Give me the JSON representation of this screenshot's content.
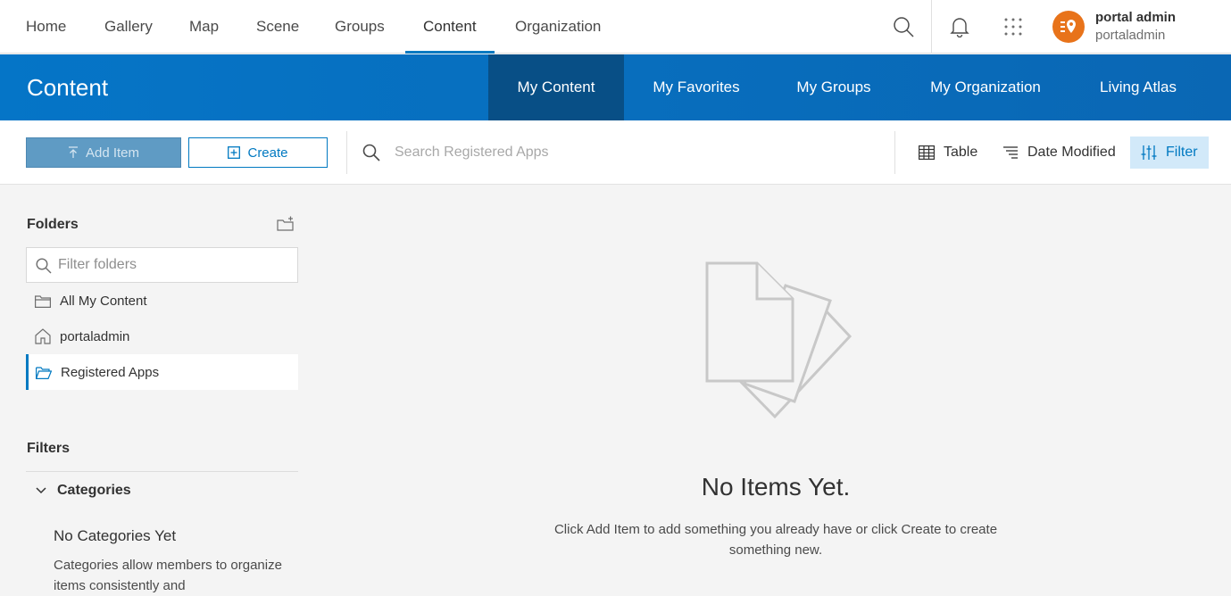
{
  "topnav": {
    "items": [
      "Home",
      "Gallery",
      "Map",
      "Scene",
      "Groups",
      "Content",
      "Organization"
    ],
    "active": "Content",
    "user": {
      "name": "portal admin",
      "handle": "portaladmin"
    }
  },
  "header": {
    "title": "Content",
    "tabs": [
      "My Content",
      "My Favorites",
      "My Groups",
      "My Organization",
      "Living Atlas"
    ],
    "active_tab": "My Content"
  },
  "toolbar": {
    "add_item": "Add Item",
    "create": "Create",
    "search_placeholder": "Search Registered Apps",
    "table": "Table",
    "date_modified": "Date Modified",
    "filter": "Filter"
  },
  "sidebar": {
    "folders_heading": "Folders",
    "filter_placeholder": "Filter folders",
    "folders": [
      "All My Content",
      "portaladmin",
      "Registered Apps"
    ],
    "active_folder": "Registered Apps",
    "filters_heading": "Filters",
    "categories_label": "Categories",
    "no_categories_title": "No Categories Yet",
    "no_categories_desc": "Categories allow members to organize items consistently and"
  },
  "empty": {
    "title": "No Items Yet.",
    "desc": "Click Add Item to add something you already have or click Create to create something new."
  },
  "colors": {
    "accent": "#0079c1",
    "header_blue": "#0575c7",
    "active_tab": "#084f86",
    "avatar": "#e8731a"
  }
}
